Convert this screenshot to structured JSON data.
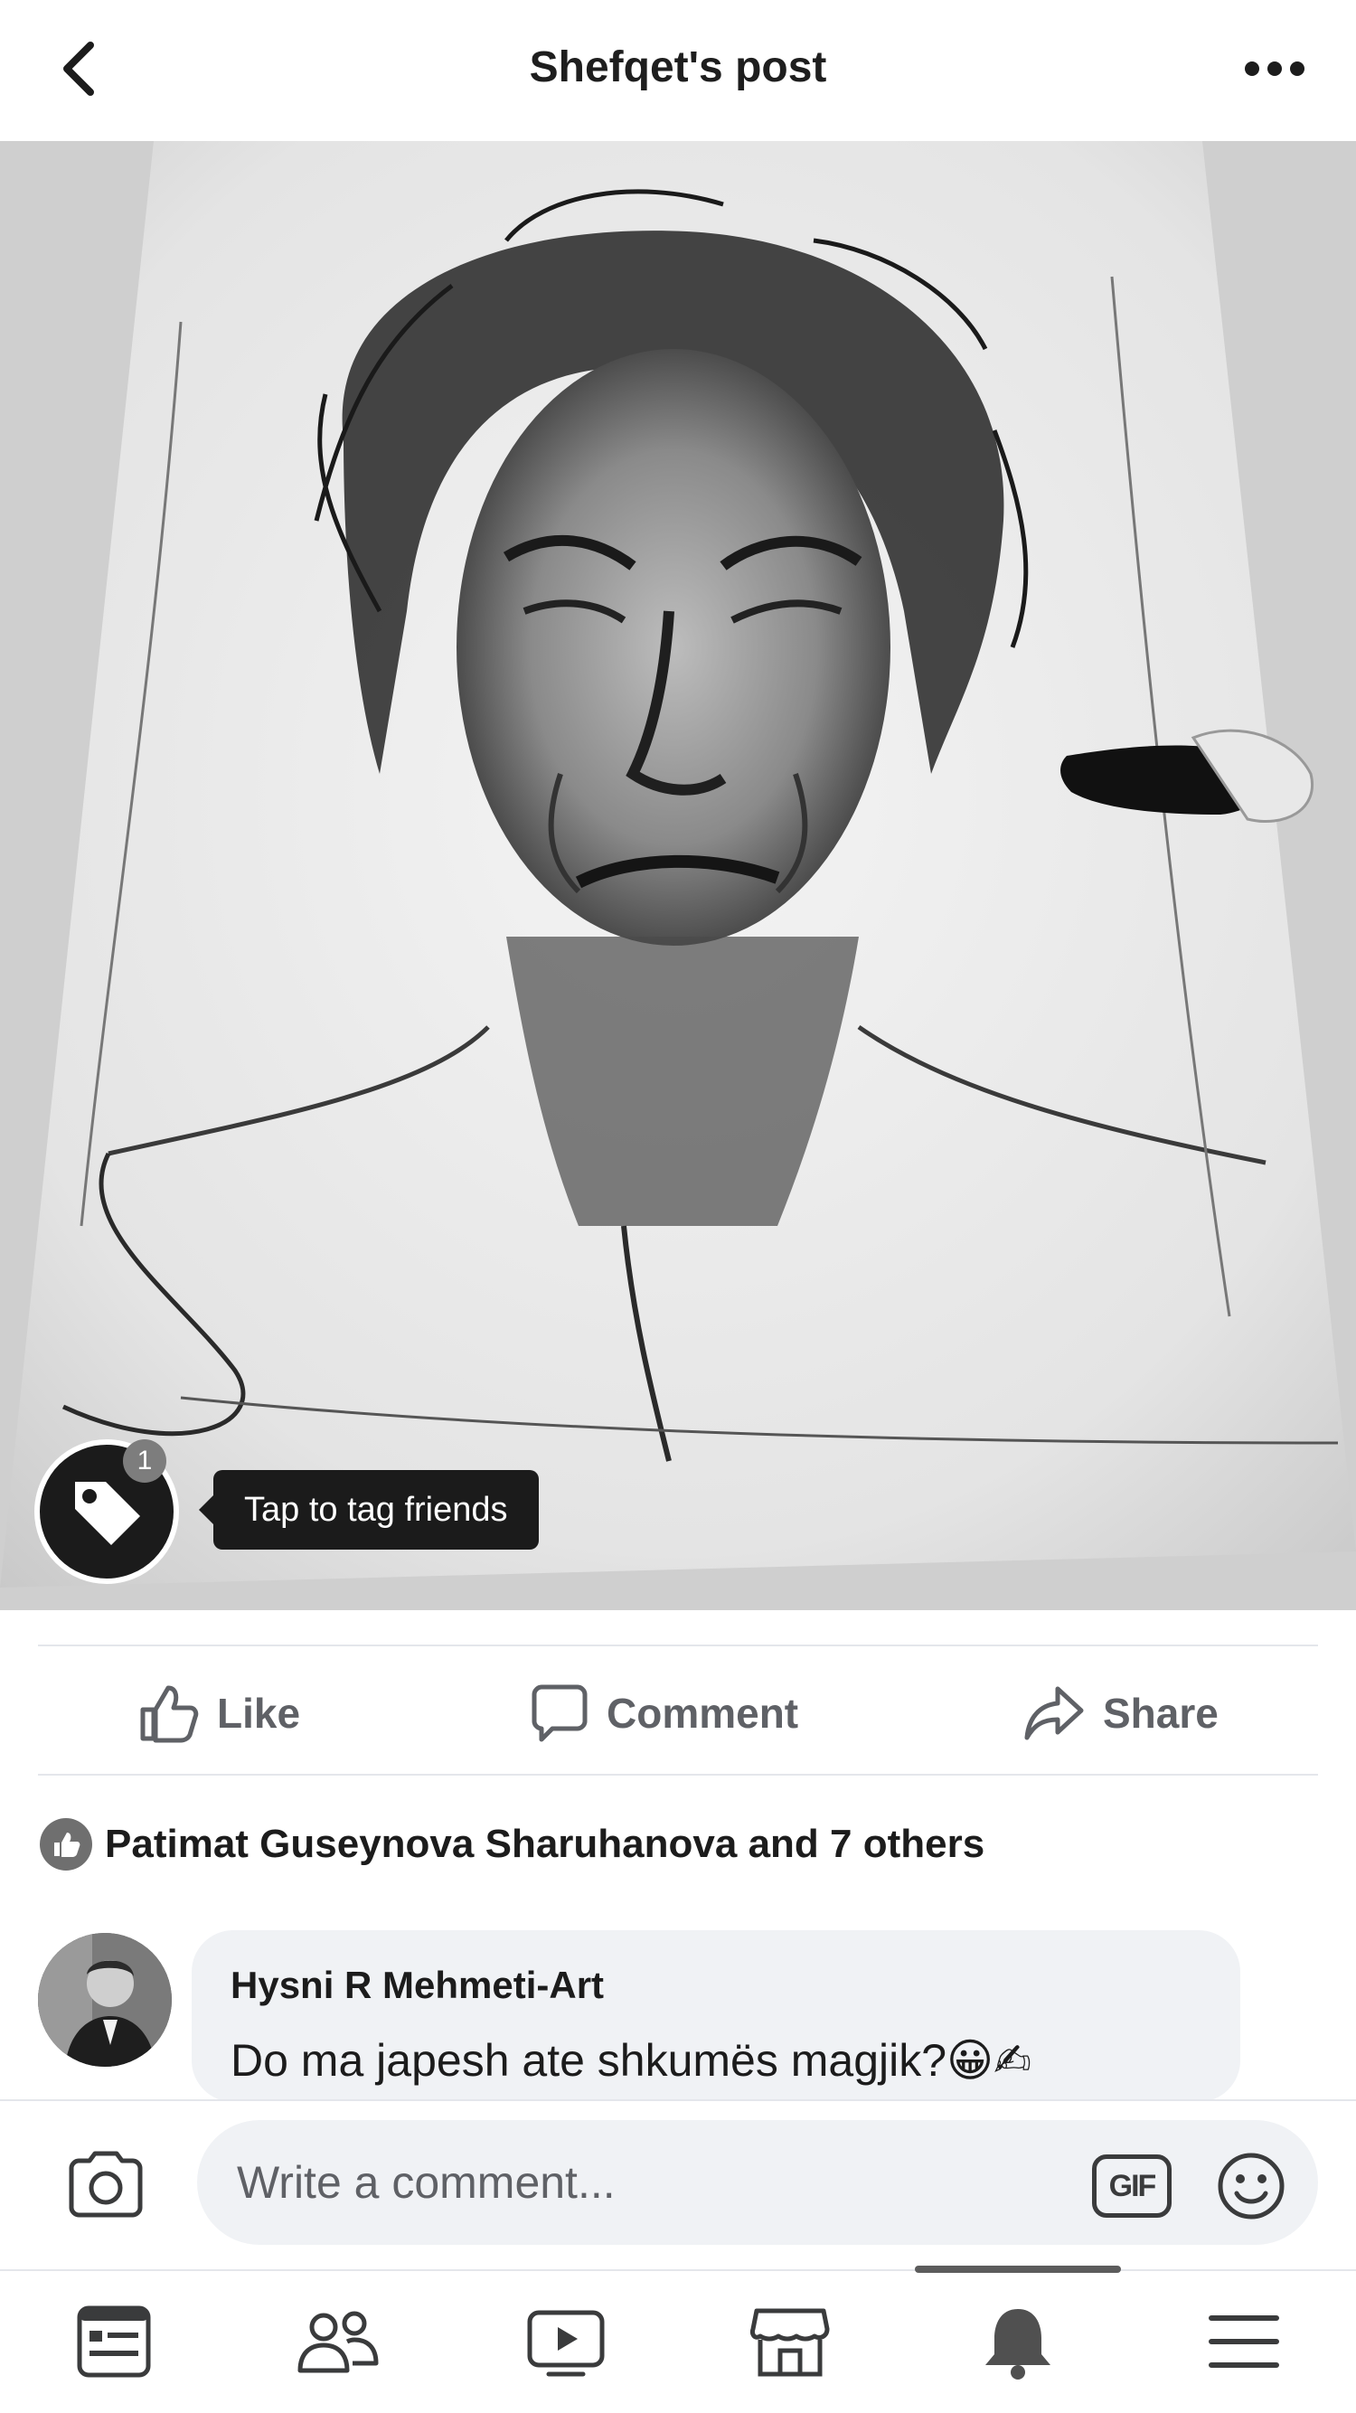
{
  "header": {
    "title": "Shefqet's post",
    "back_icon": "chevron-left-icon",
    "more_icon": "more-horizontal-icon"
  },
  "photo": {
    "tag_count": "1",
    "tag_tooltip": "Tap to tag friends",
    "tag_icon": "tag-icon"
  },
  "actions": {
    "like": "Like",
    "comment": "Comment",
    "share": "Share"
  },
  "reactions": {
    "text": "Patimat Guseynova Sharuhanova and 7 others",
    "icon": "like-reaction-icon"
  },
  "comment": {
    "author": "Hysni R Mehmeti-Art",
    "text": "Do ma japesh ate shkumës magjik?😀✍"
  },
  "composer": {
    "placeholder": "Write a comment...",
    "gif_label": "GIF",
    "camera_icon": "camera-icon",
    "emoji_icon": "smiley-icon"
  },
  "bottom_nav": {
    "items": [
      "news-feed-icon",
      "friends-icon",
      "watch-icon",
      "marketplace-icon",
      "notifications-icon",
      "menu-icon"
    ],
    "active": "notifications-icon"
  },
  "colors": {
    "divider": "#e4e6eb",
    "bubble": "#f0f2f5",
    "secondary_text": "#5f6166"
  }
}
